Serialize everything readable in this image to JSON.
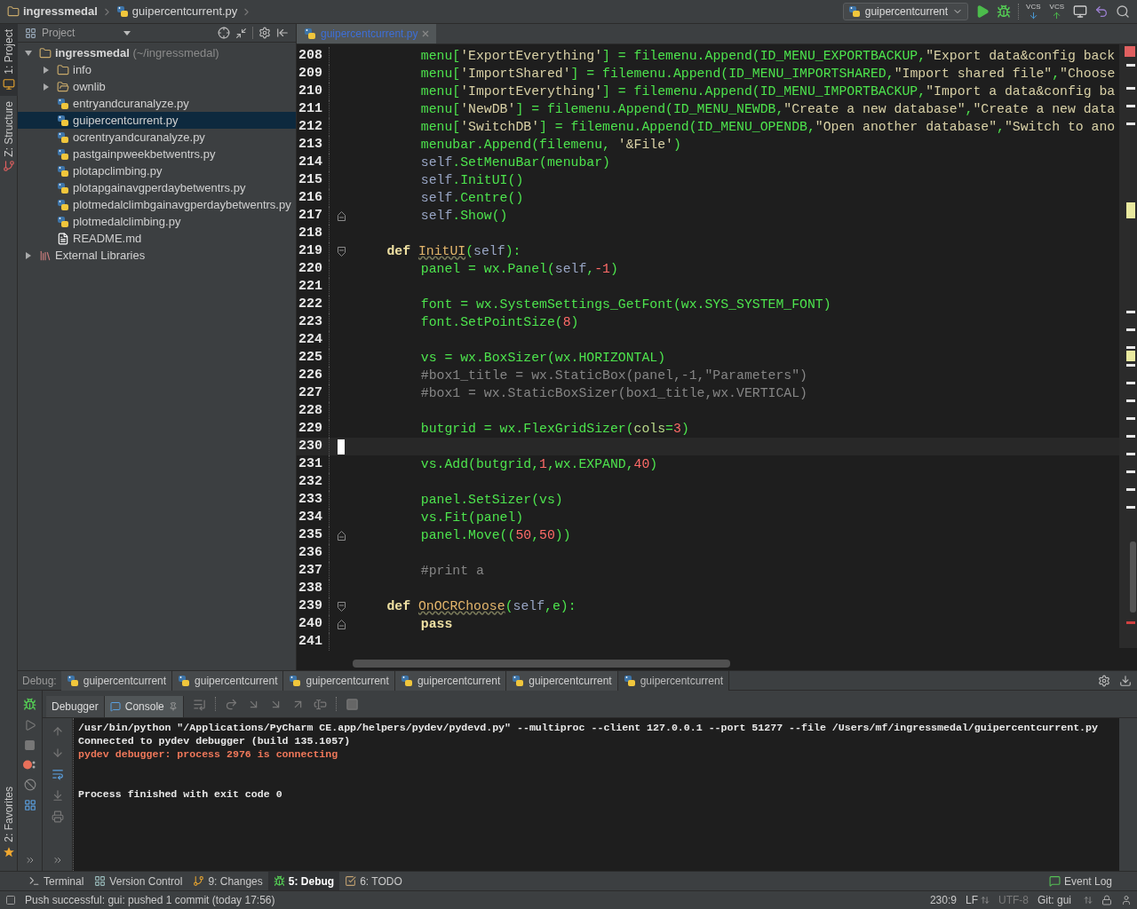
{
  "breadcrumbs": [
    {
      "label": "ingressmedal",
      "kind": "folder"
    },
    {
      "label": "guipercentcurrent.py",
      "kind": "file"
    }
  ],
  "toolbar": {
    "run_config": "guipercentcurrent",
    "vcs_update": "VCS",
    "vcs_commit": "VCS"
  },
  "tool_stripe": [
    {
      "label": "1: Project",
      "selected": true,
      "kind": "project"
    },
    {
      "label": "Z: Structure",
      "selected": false,
      "kind": "structure"
    },
    {
      "label": "2: Favorites",
      "selected": false,
      "kind": "favorites"
    }
  ],
  "project": {
    "title": "Project",
    "tree": [
      {
        "label": "ingressmedal",
        "note": "(~/ingressmedal)",
        "kind": "module",
        "expanded": true,
        "selected": false,
        "children": [
          {
            "label": "info",
            "kind": "folder",
            "expanded": false,
            "selected": false
          },
          {
            "label": "ownlib",
            "kind": "package",
            "expanded": false,
            "selected": false
          },
          {
            "label": "entryandcuranalyze.py",
            "kind": "python",
            "selected": false
          },
          {
            "label": "guipercentcurrent.py",
            "kind": "python",
            "selected": true
          },
          {
            "label": "ocrentryandcuranalyze.py",
            "kind": "python",
            "selected": false
          },
          {
            "label": "pastgainpweekbetwentrs.py",
            "kind": "python",
            "selected": false
          },
          {
            "label": "plotapclimbing.py",
            "kind": "python",
            "selected": false
          },
          {
            "label": "plotapgainavgperdaybetwentrs.py",
            "kind": "python",
            "selected": false
          },
          {
            "label": "plotmedalclimbgainavgperdaybetwentrs.py",
            "kind": "python",
            "selected": false
          },
          {
            "label": "plotmedalclimbing.py",
            "kind": "python",
            "selected": false
          },
          {
            "label": "README.md",
            "kind": "markdown",
            "selected": false
          }
        ]
      },
      {
        "label": "External Libraries",
        "kind": "library",
        "expanded": false,
        "selected": false
      }
    ]
  },
  "editor": {
    "tabs": [
      {
        "label": "guipercentcurrent.py",
        "modified": true,
        "selected": true
      }
    ],
    "lines": [
      {
        "number": "208",
        "current": false,
        "tokens": [
          {
            "kind": "code",
            "text": "        menu["
          },
          {
            "kind": "string",
            "text": "'ExportEverything'"
          },
          {
            "kind": "code",
            "text": "] = filemenu.Append(ID_MENU_EXPORTBACKUP,"
          },
          {
            "kind": "string",
            "text": "\"Export data&config back"
          }
        ]
      },
      {
        "number": "209",
        "current": false,
        "tokens": [
          {
            "kind": "code",
            "text": "        menu["
          },
          {
            "kind": "string",
            "text": "'ImportShared'"
          },
          {
            "kind": "code",
            "text": "] = filemenu.Append(ID_MENU_IMPORTSHARED,"
          },
          {
            "kind": "string",
            "text": "\"Import shared file\""
          },
          {
            "kind": "code",
            "text": ","
          },
          {
            "kind": "string",
            "text": "\"Choose"
          }
        ]
      },
      {
        "number": "210",
        "current": false,
        "tokens": [
          {
            "kind": "code",
            "text": "        menu["
          },
          {
            "kind": "string",
            "text": "'ImportEverything'"
          },
          {
            "kind": "code",
            "text": "] = filemenu.Append(ID_MENU_IMPORTBACKUP,"
          },
          {
            "kind": "string",
            "text": "\"Import a data&config ba"
          }
        ]
      },
      {
        "number": "211",
        "current": false,
        "tokens": [
          {
            "kind": "code",
            "text": "        menu["
          },
          {
            "kind": "string",
            "text": "'NewDB'"
          },
          {
            "kind": "code",
            "text": "] = filemenu.Append(ID_MENU_NEWDB,"
          },
          {
            "kind": "string",
            "text": "\"Create a new database\""
          },
          {
            "kind": "code",
            "text": ","
          },
          {
            "kind": "string",
            "text": "\"Create a new data"
          }
        ]
      },
      {
        "number": "212",
        "current": false,
        "tokens": [
          {
            "kind": "code",
            "text": "        menu["
          },
          {
            "kind": "string",
            "text": "'SwitchDB'"
          },
          {
            "kind": "code",
            "text": "] = filemenu.Append(ID_MENU_OPENDB,"
          },
          {
            "kind": "string",
            "text": "\"Open another database\""
          },
          {
            "kind": "code",
            "text": ","
          },
          {
            "kind": "string",
            "text": "\"Switch to ano"
          }
        ]
      },
      {
        "number": "213",
        "current": false,
        "tokens": [
          {
            "kind": "code",
            "text": "        menubar.Append(filemenu, "
          },
          {
            "kind": "string",
            "text": "'&File'"
          },
          {
            "kind": "code",
            "text": ")"
          }
        ]
      },
      {
        "number": "214",
        "current": false,
        "tokens": [
          {
            "kind": "self",
            "text": "        self"
          },
          {
            "kind": "code",
            "text": ".SetMenuBar(menubar)"
          }
        ]
      },
      {
        "number": "215",
        "current": false,
        "tokens": [
          {
            "kind": "self",
            "text": "        self"
          },
          {
            "kind": "code",
            "text": ".InitUI()"
          }
        ]
      },
      {
        "number": "216",
        "current": false,
        "tokens": [
          {
            "kind": "self",
            "text": "        self"
          },
          {
            "kind": "code",
            "text": ".Centre()"
          }
        ]
      },
      {
        "number": "217",
        "current": false,
        "fold_end": true,
        "tokens": [
          {
            "kind": "self",
            "text": "        self"
          },
          {
            "kind": "code",
            "text": ".Show()"
          }
        ]
      },
      {
        "number": "218",
        "current": false
      },
      {
        "number": "219",
        "current": false,
        "fold_start": true,
        "tokens": [
          {
            "kind": "keyword",
            "text": "    def "
          },
          {
            "kind": "defname",
            "text": "InitUI"
          },
          {
            "kind": "code",
            "text": "("
          },
          {
            "kind": "self",
            "text": "self"
          },
          {
            "kind": "code",
            "text": "):"
          }
        ]
      },
      {
        "number": "220",
        "current": false,
        "tokens": [
          {
            "kind": "code",
            "text": "        panel = wx.Panel("
          },
          {
            "kind": "self",
            "text": "self"
          },
          {
            "kind": "code",
            "text": ","
          },
          {
            "kind": "number",
            "text": "-1"
          },
          {
            "kind": "code",
            "text": ")"
          }
        ]
      },
      {
        "number": "221",
        "current": false
      },
      {
        "number": "222",
        "current": false,
        "tokens": [
          {
            "kind": "code",
            "text": "        font = wx.SystemSettings_GetFont(wx.SYS_SYSTEM_FONT)"
          }
        ]
      },
      {
        "number": "223",
        "current": false,
        "tokens": [
          {
            "kind": "code",
            "text": "        font.SetPointSize("
          },
          {
            "kind": "number",
            "text": "8"
          },
          {
            "kind": "code",
            "text": ")"
          }
        ]
      },
      {
        "number": "224",
        "current": false
      },
      {
        "number": "225",
        "current": false,
        "tokens": [
          {
            "kind": "code",
            "text": "        vs = wx.BoxSizer(wx.HORIZONTAL)"
          }
        ]
      },
      {
        "number": "226",
        "current": false,
        "tokens": [
          {
            "kind": "comment",
            "text": "        #box1_title = wx.StaticBox(panel,-1,\"Parameters\")"
          }
        ]
      },
      {
        "number": "227",
        "current": false,
        "tokens": [
          {
            "kind": "comment",
            "text": "        #box1 = wx.StaticBoxSizer(box1_title,wx.VERTICAL)"
          }
        ]
      },
      {
        "number": "228",
        "current": false
      },
      {
        "number": "229",
        "current": false,
        "tokens": [
          {
            "kind": "code",
            "text": "        butgrid = wx.FlexGridSizer("
          },
          {
            "kind": "param",
            "text": "cols"
          },
          {
            "kind": "code",
            "text": "="
          },
          {
            "kind": "number",
            "text": "3"
          },
          {
            "kind": "code",
            "text": ")"
          }
        ]
      },
      {
        "number": "230",
        "current": true
      },
      {
        "number": "231",
        "current": false,
        "tokens": [
          {
            "kind": "code",
            "text": "        vs.Add(butgrid,"
          },
          {
            "kind": "number",
            "text": "1"
          },
          {
            "kind": "code",
            "text": ",wx.EXPAND,"
          },
          {
            "kind": "number",
            "text": "40"
          },
          {
            "kind": "code",
            "text": ")"
          }
        ]
      },
      {
        "number": "232",
        "current": false
      },
      {
        "number": "233",
        "current": false,
        "tokens": [
          {
            "kind": "code",
            "text": "        panel.SetSizer(vs)"
          }
        ]
      },
      {
        "number": "234",
        "current": false,
        "tokens": [
          {
            "kind": "code",
            "text": "        vs.Fit(panel)"
          }
        ]
      },
      {
        "number": "235",
        "current": false,
        "fold_end": true,
        "tokens": [
          {
            "kind": "code",
            "text": "        panel.Move(("
          },
          {
            "kind": "number",
            "text": "50"
          },
          {
            "kind": "code",
            "text": ","
          },
          {
            "kind": "number",
            "text": "50"
          },
          {
            "kind": "code",
            "text": "))"
          }
        ]
      },
      {
        "number": "236",
        "current": false
      },
      {
        "number": "237",
        "current": false,
        "tokens": [
          {
            "kind": "comment",
            "text": "        #print a"
          }
        ]
      },
      {
        "number": "238",
        "current": false
      },
      {
        "number": "239",
        "current": false,
        "fold_start": true,
        "tokens": [
          {
            "kind": "keyword",
            "text": "    def "
          },
          {
            "kind": "defname",
            "text": "OnOCRChoose"
          },
          {
            "kind": "code",
            "text": "("
          },
          {
            "kind": "self",
            "text": "self"
          },
          {
            "kind": "code",
            "text": ",e):"
          }
        ]
      },
      {
        "number": "240",
        "current": false,
        "fold_end": true,
        "tokens": [
          {
            "kind": "keyword",
            "text": "        pass"
          }
        ]
      },
      {
        "number": "241",
        "current": false
      }
    ]
  },
  "debug": {
    "label": "Debug:",
    "sessions": [
      {
        "label": "guipercentcurrent",
        "selected": false
      },
      {
        "label": "guipercentcurrent",
        "selected": false
      },
      {
        "label": "guipercentcurrent",
        "selected": false
      },
      {
        "label": "guipercentcurrent",
        "selected": false
      },
      {
        "label": "guipercentcurrent",
        "selected": false
      },
      {
        "label": "guipercentcurrent",
        "selected": true
      }
    ],
    "tabs": [
      {
        "label": "Debugger",
        "selected": false
      },
      {
        "label": "Console",
        "selected": true
      }
    ],
    "console": [
      {
        "text": "/usr/bin/python \"/Applications/PyCharm CE.app/helpers/pydev/pydevd.py\" --multiproc --client 127.0.0.1 --port 51277 --file /Users/mf/ingressmedal/guipercentcurrent.py",
        "kind": "output"
      },
      {
        "text": "Connected to pydev debugger (build 135.1057)",
        "kind": "output"
      },
      {
        "text": "pydev debugger: process 2976 is connecting",
        "kind": "error"
      },
      {
        "kind": "blank"
      },
      {
        "kind": "blank"
      },
      {
        "text": "Process finished with exit code 0",
        "kind": "output"
      }
    ]
  },
  "tool_windows": [
    {
      "label": "Terminal",
      "selected": false,
      "kind": "terminal"
    },
    {
      "label": "Version Control",
      "selected": false,
      "kind": "vcs"
    },
    {
      "label": "9: Changes",
      "selected": false,
      "kind": "changes"
    },
    {
      "label": "5: Debug",
      "selected": true,
      "kind": "debug"
    },
    {
      "label": "6: TODO",
      "selected": false,
      "kind": "todo"
    }
  ],
  "event_log": "Event Log",
  "status": {
    "message": "Push successful: gui: pushed 1 commit (today 17:56)",
    "position": "230:9",
    "line_separator": "LF",
    "encoding": "UTF-8",
    "vcs": "Git: gui"
  }
}
